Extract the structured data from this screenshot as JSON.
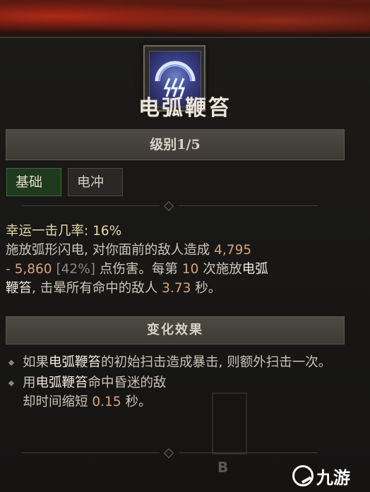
{
  "skill": {
    "name": "电弧鞭笞",
    "rank": "级别1/5",
    "tags": [
      "基础",
      "电冲"
    ]
  },
  "description": {
    "lucky_hit_label": "幸运一击几率:",
    "lucky_hit_value": "16%",
    "line_a": "施放弧形闪电, 对你面前的敌人造成",
    "damage_min": "4,795",
    "damage_sep": "-",
    "damage_max": "5,860",
    "damage_pct": "[42%]",
    "damage_suffix": "点伤害。每第",
    "cast_count": "10",
    "cast_suffix": "次施放",
    "skill_ref": "电弧",
    "skill_ref2": "鞭笞",
    "stun_text": ", 击晕所有命中的敌人",
    "stun_value": "3.73",
    "stun_unit": "秒。"
  },
  "modifiers": {
    "header": "变化效果",
    "items": [
      {
        "pre": "如果",
        "skill": "电弧鞭笞",
        "post": "的初始扫击造成暴击, 则额外扫击一次。"
      },
      {
        "pre": "用",
        "skill": "电弧鞭笞",
        "post": "命中昏迷的敌",
        "post2": "却时间缩短",
        "value": "0.15",
        "unit": "秒。"
      }
    ]
  },
  "watermark": {
    "letter": "B",
    "logo_text": "九游"
  },
  "colors": {
    "highlight": "#e6d9a3",
    "number": "#d9a37a",
    "tag_active": "#1f3a1e"
  }
}
